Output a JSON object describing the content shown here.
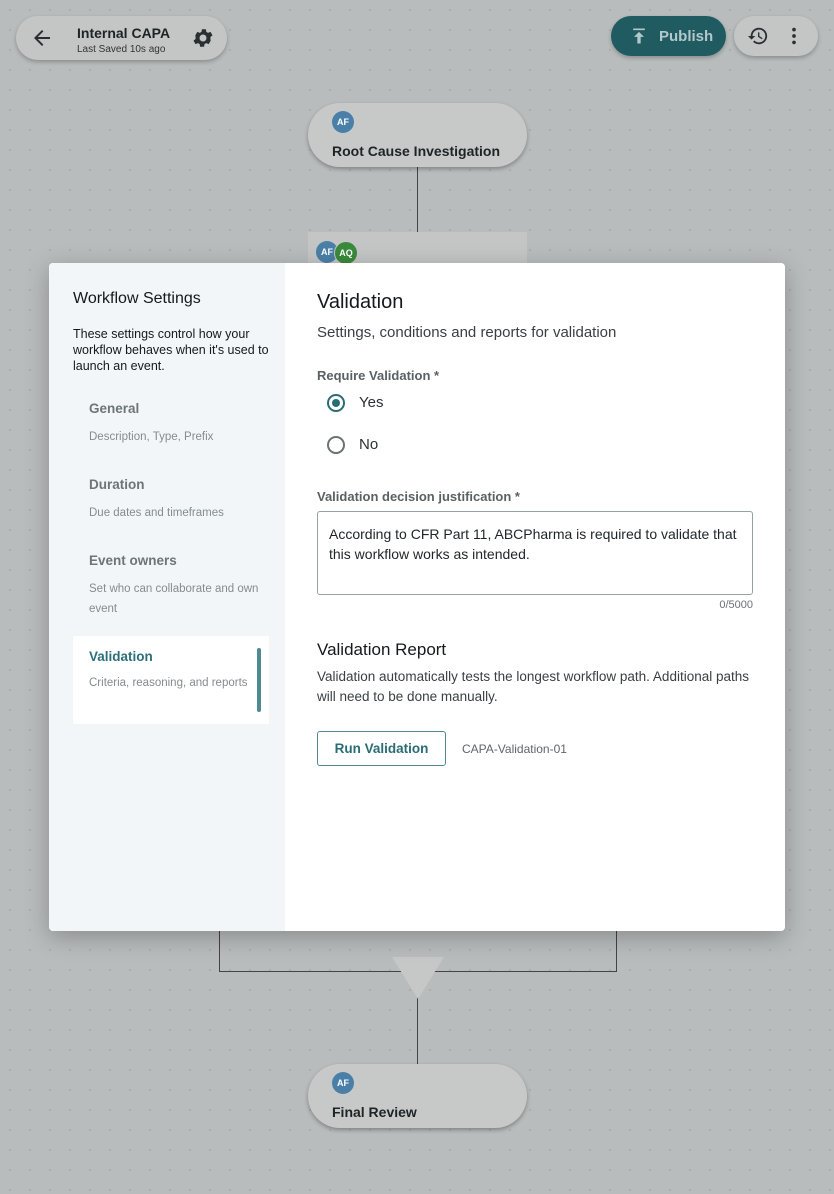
{
  "header": {
    "title": "Internal CAPA",
    "saved": "Last Saved 10s ago",
    "publish_label": "Publish",
    "back_icon": "arrow-left-icon",
    "settings_icon": "gear-icon"
  },
  "canvas": {
    "nodes": [
      {
        "label": "Root Cause Investigation",
        "avatar": "AF"
      },
      {
        "label": "Final Review",
        "avatar": "AF"
      }
    ],
    "card_avatars": [
      "AF",
      "AQ"
    ]
  },
  "modal": {
    "sidebar": {
      "title": "Workflow Settings",
      "description": "These settings control how your workflow behaves when it's used to launch an event.",
      "items": [
        {
          "label": "General",
          "sub": "Description, Type, Prefix"
        },
        {
          "label": "Duration",
          "sub": "Due dates and timeframes"
        },
        {
          "label": "Event owners",
          "sub": "Set who can collaborate and own event"
        },
        {
          "label": "Validation",
          "sub": "Criteria, reasoning, and reports"
        }
      ]
    },
    "content": {
      "title": "Validation",
      "subtitle": "Settings, conditions and reports for validation",
      "require_label": "Require Validation *",
      "options": [
        "Yes",
        "No"
      ],
      "selected": "Yes",
      "justification_label": "Validation decision justification *",
      "justification_value": "According to CFR Part 11, ABCPharma is required to validate that this workflow works as intended.",
      "counter": "0/5000",
      "report_title": "Validation Report",
      "report_desc": "Validation automatically tests the longest workflow path. Additional paths will need to be done manually.",
      "run_button": "Run Validation",
      "report_id": "CAPA-Validation-01"
    }
  },
  "colors": {
    "accent": "#2a6c74",
    "publish_bg": "#1f5b61",
    "avatar_af": "#4a80a8",
    "avatar_aq": "#3a8a3c"
  }
}
